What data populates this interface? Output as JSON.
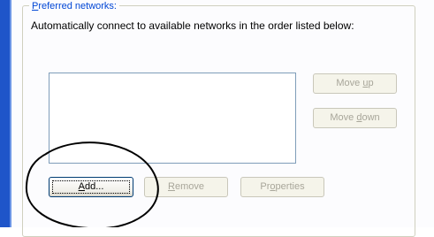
{
  "group": {
    "legend_prefix": "",
    "legend_accel": "P",
    "legend_rest": "referred networks:"
  },
  "description": "Automatically connect to available networks in the order listed below:",
  "networks": [],
  "buttons": {
    "move_up": {
      "pre": "Move ",
      "accel": "u",
      "post": "p"
    },
    "move_down": {
      "pre": "Move ",
      "accel": "d",
      "post": "own"
    },
    "add": {
      "pre": "",
      "accel": "A",
      "post": "dd..."
    },
    "remove": {
      "pre": "",
      "accel": "R",
      "post": "emove"
    },
    "properties": {
      "pre": "Pr",
      "accel": "o",
      "post": "perties"
    }
  },
  "colors": {
    "title_frame": "#1f55c9",
    "legend_text": "#0046d5",
    "annotation": "#000000"
  }
}
